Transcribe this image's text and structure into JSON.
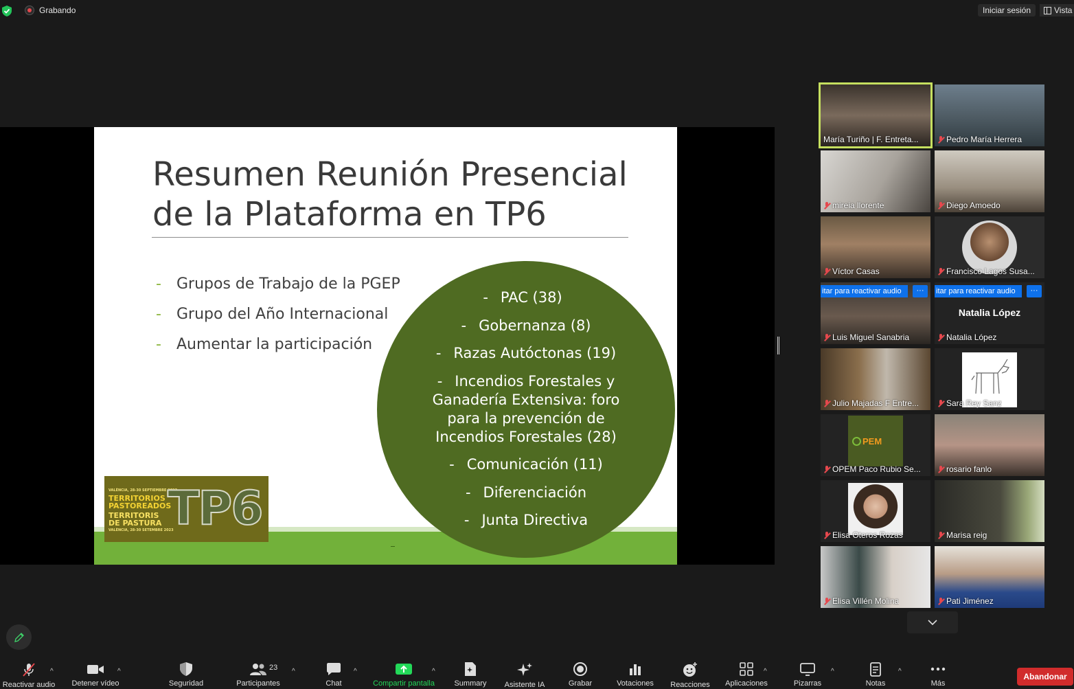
{
  "top_bar": {
    "recording_label": "Grabando",
    "sign_in_label": "Iniciar sesión",
    "view_label": "Vista"
  },
  "slide": {
    "title": "Resumen Reunión Presencial de la Plataforma en TP6",
    "bullets": [
      "Grupos de Trabajo de la PGEP",
      "Grupo del Año Internacional",
      "Aumentar la participación"
    ],
    "working_groups": [
      "PAC (38)",
      "Gobernanza (8)",
      "Razas Autóctonas (19)",
      "Incendios Forestales y Ganadería Extensiva: foro para la prevención de Incendios Forestales (28)",
      "Comunicación (11)",
      "Diferenciación",
      "Junta Directiva"
    ],
    "logo": {
      "date_top": "VALÈNCIA, 28-30 SEPTIEMBRE 2023",
      "line1": "TERRITORIOS",
      "line2": "PASTOREADOS",
      "line3": "TERRITORIS",
      "line4": "DE PASTURA",
      "date_bottom": "VALÈNCIA, 28-30 SETEMBRE 2023",
      "mark": "TP6"
    }
  },
  "gallery": {
    "unmute_prompt": "itar para reactivar audio",
    "more_label": "···",
    "participants": [
      {
        "name": "María Turiño | F. Entreta...",
        "muted": false,
        "active": true
      },
      {
        "name": "Pedro María Herrera",
        "muted": true
      },
      {
        "name": "mireia llorente",
        "muted": true
      },
      {
        "name": "Diego Amoedo",
        "muted": true
      },
      {
        "name": "Víctor Casas",
        "muted": true
      },
      {
        "name": "Francisco Lagos Susa...",
        "muted": true
      },
      {
        "name": "Luis Miguel Sanabria",
        "muted": true
      },
      {
        "name": "Natalia López",
        "muted": true
      },
      {
        "name": "Julio Majadas F Entre...",
        "muted": true
      },
      {
        "name": "Sara Rey Sanz",
        "muted": true
      },
      {
        "name": "OPEM Paco Rubio Se...",
        "muted": true
      },
      {
        "name": "rosario fanlo",
        "muted": true
      },
      {
        "name": "Elisa Oteros Rozas",
        "muted": true
      },
      {
        "name": "Marisa reig",
        "muted": true
      },
      {
        "name": "Elisa Villén Molina",
        "muted": true
      },
      {
        "name": "Pati Jiménez",
        "muted": true
      }
    ],
    "no_video_name": "Natalia López",
    "opem_logo": "PEM"
  },
  "toolbar": {
    "participants_count": "23",
    "items": [
      {
        "label": "Reactivar audio",
        "icon": "mic-muted-icon"
      },
      {
        "label": "Detener vídeo",
        "icon": "video-icon"
      },
      {
        "label": "Seguridad",
        "icon": "shield-icon"
      },
      {
        "label": "Participantes",
        "icon": "participants-icon"
      },
      {
        "label": "Chat",
        "icon": "chat-icon"
      },
      {
        "label": "Compartir pantalla",
        "icon": "share-screen-icon"
      },
      {
        "label": "Summary",
        "icon": "summary-icon"
      },
      {
        "label": "Asistente IA",
        "icon": "sparkle-icon"
      },
      {
        "label": "Grabar",
        "icon": "record-icon"
      },
      {
        "label": "Votaciones",
        "icon": "polls-icon"
      },
      {
        "label": "Reacciones",
        "icon": "reactions-icon"
      },
      {
        "label": "Aplicaciones",
        "icon": "apps-icon"
      },
      {
        "label": "Pizarras",
        "icon": "whiteboard-icon"
      },
      {
        "label": "Notas",
        "icon": "notes-icon"
      },
      {
        "label": "Más",
        "icon": "more-icon"
      }
    ],
    "leave_label": "Abandonar"
  },
  "colors": {
    "accent_green": "#c5df5f",
    "share_green": "#23d959",
    "leave_red": "#d12c2c",
    "unmute_blue": "#0e71eb",
    "slide_circle": "#4f6b22"
  }
}
